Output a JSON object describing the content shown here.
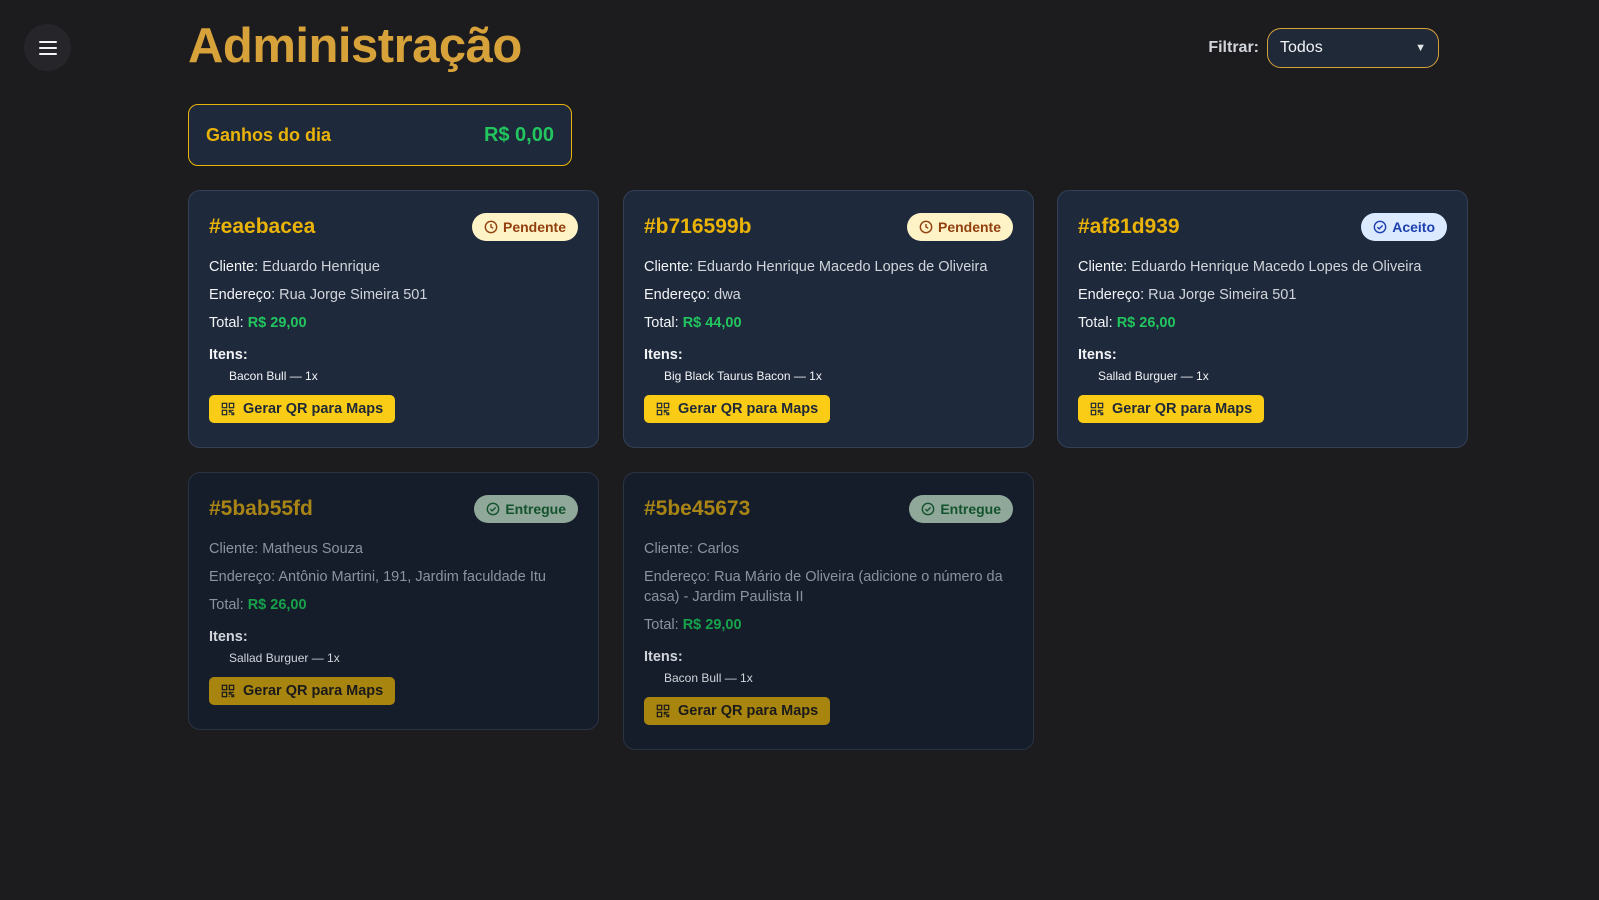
{
  "header": {
    "title": "Administração",
    "filter_label": "Filtrar:",
    "filter_value": "Todos"
  },
  "earnings": {
    "label": "Ganhos do dia",
    "value": "R$ 0,00"
  },
  "labels": {
    "client": "Cliente:",
    "address": "Endereço:",
    "total": "Total:",
    "items": "Itens:",
    "qr_button": "Gerar QR para Maps"
  },
  "orders": [
    {
      "id": "#eaebacea",
      "status": "Pendente",
      "client": "Eduardo Henrique",
      "address": "Rua Jorge Simeira 501",
      "total": "R$ 29,00",
      "items": [
        "Bacon Bull — 1x"
      ]
    },
    {
      "id": "#b716599b",
      "status": "Pendente",
      "client": "Eduardo Henrique Macedo Lopes de Oliveira",
      "address": "dwa",
      "total": "R$ 44,00",
      "items": [
        "Big Black Taurus Bacon — 1x"
      ]
    },
    {
      "id": "#af81d939",
      "status": "Aceito",
      "client": "Eduardo Henrique Macedo Lopes de Oliveira",
      "address": "Rua Jorge Simeira 501",
      "total": "R$ 26,00",
      "items": [
        "Sallad Burguer — 1x"
      ]
    },
    {
      "id": "#5bab55fd",
      "status": "Entregue",
      "client": "Matheus Souza",
      "address": "Antônio Martini, 191, Jardim faculdade Itu",
      "total": "R$ 26,00",
      "items": [
        "Sallad Burguer — 1x"
      ]
    },
    {
      "id": "#5be45673",
      "status": "Entregue",
      "client": "Carlos",
      "address": "Rua Mário de Oliveira (adicione o número da casa) - Jardim Paulista II",
      "total": "R$ 29,00",
      "items": [
        "Bacon Bull — 1x"
      ]
    }
  ]
}
